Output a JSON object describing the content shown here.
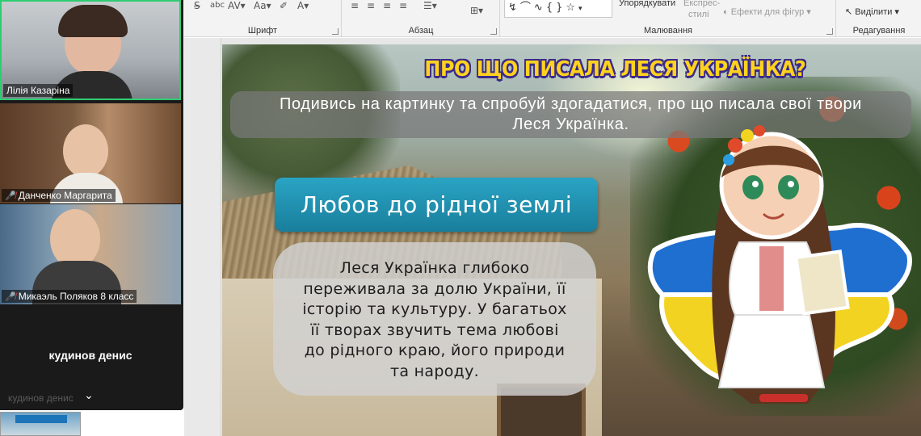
{
  "ribbon": {
    "font_group": "Шрифт",
    "paragraph_group": "Абзац",
    "drawing_group": "Малювання",
    "editing_group": "Редагування",
    "arrange_label": "Упорядкувати",
    "quick_styles_label_1": "Експрес-",
    "quick_styles_label_2": "стилі",
    "shape_effects_label": "Ефекти для фігур",
    "select_label": "Виділити"
  },
  "slide": {
    "title": "ПРО ЩО ПИСАЛА ЛЕСЯ УКРАЇНКА?",
    "prompt_line1": "Подивись на картинку та спробуй здогадатися, про що писала свої твори",
    "prompt_line2": "Леся Українка.",
    "topic": "Любов до рідної землі",
    "desc_lines": [
      "Леся Українка глибоко",
      "переживала за долю України, її",
      "історію та культуру. У багатьох",
      "її творах звучить тема любові",
      "до рідного краю, його природи",
      "та народу."
    ]
  },
  "participants": [
    {
      "name": "Лілія Казаріна",
      "muted": false,
      "active": true
    },
    {
      "name": "Данченко Маргарита",
      "muted": true
    },
    {
      "name": "Микаэль Поляков 8 класс",
      "muted": true
    },
    {
      "name": "кудинов денис",
      "muted": true,
      "camera_off": true
    }
  ],
  "participant4_ghost": "кудинов денис",
  "colors": {
    "active_border": "#2ecc71",
    "topic_bg": "#2aa4c4",
    "title_fill": "#ffd21e",
    "title_outline": "#3b2a8a",
    "ua_blue": "#1f6fd1",
    "ua_yellow": "#f3d322"
  },
  "icons": [
    "strikethrough-icon",
    "char-spacing-icon",
    "font-case-icon",
    "font-color-icon",
    "align-left-icon",
    "align-center-icon",
    "align-right-icon",
    "justify-icon",
    "columns-icon",
    "smartart-icon",
    "star-shape-icon",
    "mic-off-icon",
    "chevron-down-icon"
  ]
}
